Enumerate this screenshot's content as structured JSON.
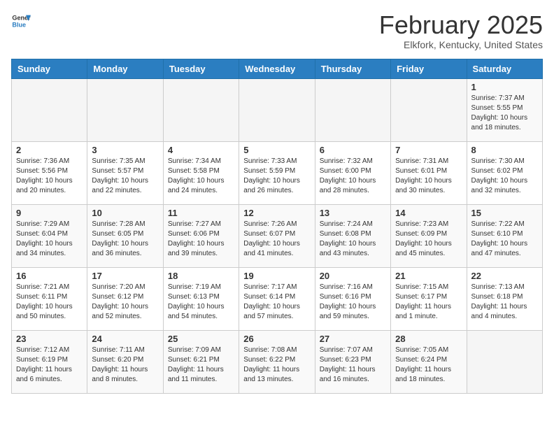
{
  "header": {
    "logo": {
      "general": "General",
      "blue": "Blue"
    },
    "title": "February 2025",
    "subtitle": "Elkfork, Kentucky, United States"
  },
  "weekdays": [
    "Sunday",
    "Monday",
    "Tuesday",
    "Wednesday",
    "Thursday",
    "Friday",
    "Saturday"
  ],
  "weeks": [
    [
      {
        "day": "",
        "info": ""
      },
      {
        "day": "",
        "info": ""
      },
      {
        "day": "",
        "info": ""
      },
      {
        "day": "",
        "info": ""
      },
      {
        "day": "",
        "info": ""
      },
      {
        "day": "",
        "info": ""
      },
      {
        "day": "1",
        "info": "Sunrise: 7:37 AM\nSunset: 5:55 PM\nDaylight: 10 hours\nand 18 minutes."
      }
    ],
    [
      {
        "day": "2",
        "info": "Sunrise: 7:36 AM\nSunset: 5:56 PM\nDaylight: 10 hours\nand 20 minutes."
      },
      {
        "day": "3",
        "info": "Sunrise: 7:35 AM\nSunset: 5:57 PM\nDaylight: 10 hours\nand 22 minutes."
      },
      {
        "day": "4",
        "info": "Sunrise: 7:34 AM\nSunset: 5:58 PM\nDaylight: 10 hours\nand 24 minutes."
      },
      {
        "day": "5",
        "info": "Sunrise: 7:33 AM\nSunset: 5:59 PM\nDaylight: 10 hours\nand 26 minutes."
      },
      {
        "day": "6",
        "info": "Sunrise: 7:32 AM\nSunset: 6:00 PM\nDaylight: 10 hours\nand 28 minutes."
      },
      {
        "day": "7",
        "info": "Sunrise: 7:31 AM\nSunset: 6:01 PM\nDaylight: 10 hours\nand 30 minutes."
      },
      {
        "day": "8",
        "info": "Sunrise: 7:30 AM\nSunset: 6:02 PM\nDaylight: 10 hours\nand 32 minutes."
      }
    ],
    [
      {
        "day": "9",
        "info": "Sunrise: 7:29 AM\nSunset: 6:04 PM\nDaylight: 10 hours\nand 34 minutes."
      },
      {
        "day": "10",
        "info": "Sunrise: 7:28 AM\nSunset: 6:05 PM\nDaylight: 10 hours\nand 36 minutes."
      },
      {
        "day": "11",
        "info": "Sunrise: 7:27 AM\nSunset: 6:06 PM\nDaylight: 10 hours\nand 39 minutes."
      },
      {
        "day": "12",
        "info": "Sunrise: 7:26 AM\nSunset: 6:07 PM\nDaylight: 10 hours\nand 41 minutes."
      },
      {
        "day": "13",
        "info": "Sunrise: 7:24 AM\nSunset: 6:08 PM\nDaylight: 10 hours\nand 43 minutes."
      },
      {
        "day": "14",
        "info": "Sunrise: 7:23 AM\nSunset: 6:09 PM\nDaylight: 10 hours\nand 45 minutes."
      },
      {
        "day": "15",
        "info": "Sunrise: 7:22 AM\nSunset: 6:10 PM\nDaylight: 10 hours\nand 47 minutes."
      }
    ],
    [
      {
        "day": "16",
        "info": "Sunrise: 7:21 AM\nSunset: 6:11 PM\nDaylight: 10 hours\nand 50 minutes."
      },
      {
        "day": "17",
        "info": "Sunrise: 7:20 AM\nSunset: 6:12 PM\nDaylight: 10 hours\nand 52 minutes."
      },
      {
        "day": "18",
        "info": "Sunrise: 7:19 AM\nSunset: 6:13 PM\nDaylight: 10 hours\nand 54 minutes."
      },
      {
        "day": "19",
        "info": "Sunrise: 7:17 AM\nSunset: 6:14 PM\nDaylight: 10 hours\nand 57 minutes."
      },
      {
        "day": "20",
        "info": "Sunrise: 7:16 AM\nSunset: 6:16 PM\nDaylight: 10 hours\nand 59 minutes."
      },
      {
        "day": "21",
        "info": "Sunrise: 7:15 AM\nSunset: 6:17 PM\nDaylight: 11 hours\nand 1 minute."
      },
      {
        "day": "22",
        "info": "Sunrise: 7:13 AM\nSunset: 6:18 PM\nDaylight: 11 hours\nand 4 minutes."
      }
    ],
    [
      {
        "day": "23",
        "info": "Sunrise: 7:12 AM\nSunset: 6:19 PM\nDaylight: 11 hours\nand 6 minutes."
      },
      {
        "day": "24",
        "info": "Sunrise: 7:11 AM\nSunset: 6:20 PM\nDaylight: 11 hours\nand 8 minutes."
      },
      {
        "day": "25",
        "info": "Sunrise: 7:09 AM\nSunset: 6:21 PM\nDaylight: 11 hours\nand 11 minutes."
      },
      {
        "day": "26",
        "info": "Sunrise: 7:08 AM\nSunset: 6:22 PM\nDaylight: 11 hours\nand 13 minutes."
      },
      {
        "day": "27",
        "info": "Sunrise: 7:07 AM\nSunset: 6:23 PM\nDaylight: 11 hours\nand 16 minutes."
      },
      {
        "day": "28",
        "info": "Sunrise: 7:05 AM\nSunset: 6:24 PM\nDaylight: 11 hours\nand 18 minutes."
      },
      {
        "day": "",
        "info": ""
      }
    ]
  ]
}
